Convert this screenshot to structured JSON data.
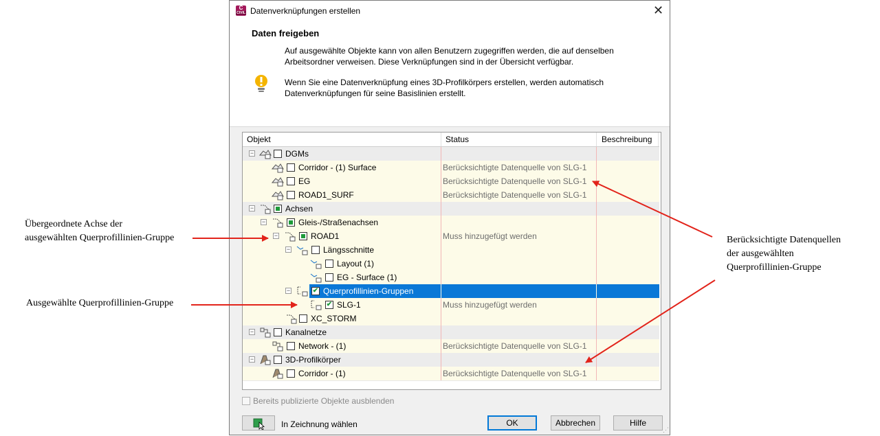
{
  "annotations": {
    "parent_axis": [
      "Übergeordnete Achse der",
      "ausgewählten Querprofillinien-Gruppe"
    ],
    "selected_group": "Ausgewählte Querprofillinien-Gruppe",
    "data_sources": [
      "Berücksichtigte Datenquellen",
      "der ausgewählten",
      "Querprofillinien-Gruppe"
    ],
    "arrow_color": "#e2231a"
  },
  "window": {
    "title": "Datenverknüpfungen erstellen",
    "app_icon_letter": "C",
    "app_icon_sub": "CIVIL",
    "close_glyph": "✕"
  },
  "header": {
    "title": "Daten freigeben",
    "paragraph1": [
      "Auf ausgewählte Objekte kann von allen Benutzern zugegriffen werden, die auf denselben",
      "Arbeitsordner verweisen. Diese Verknüpfungen sind in der Übersicht verfügbar."
    ],
    "paragraph2": [
      "Wenn Sie eine Datenverknüpfung eines 3D-Profilkörpers erstellen, werden automatisch",
      "Datenverknüpfungen für seine Basislinien erstellt."
    ],
    "info_icon": "lightbulb-icon"
  },
  "table": {
    "columns": [
      "Objekt",
      "Status",
      "Beschreibung"
    ],
    "rows": [
      {
        "label": "DGMs",
        "status": "",
        "kind": "group",
        "check": "none",
        "icon": "surface-folder-icon"
      },
      {
        "label": "Corridor - (1) Surface",
        "status": "Berücksichtigte Datenquelle von SLG-1",
        "kind": "item",
        "check": "none",
        "icon": "surface-icon"
      },
      {
        "label": "EG",
        "status": "Berücksichtigte Datenquelle von SLG-1",
        "kind": "item",
        "check": "none",
        "icon": "surface-icon"
      },
      {
        "label": "ROAD1_SURF",
        "status": "Berücksichtigte Datenquelle von SLG-1",
        "kind": "item",
        "check": "none",
        "icon": "surface-icon"
      },
      {
        "label": "Achsen",
        "status": "",
        "kind": "group",
        "check": "partial",
        "icon": "alignment-folder-icon"
      },
      {
        "label": "Gleis-/Straßenachsen",
        "status": "",
        "kind": "item",
        "check": "partial",
        "icon": "alignment-folder-icon"
      },
      {
        "label": "ROAD1",
        "status": "Muss hinzugefügt werden",
        "kind": "item",
        "check": "partial",
        "icon": "alignment-icon"
      },
      {
        "label": "Längsschnitte",
        "status": "",
        "kind": "item",
        "check": "none",
        "icon": "profile-folder-icon"
      },
      {
        "label": "Layout (1)",
        "status": "",
        "kind": "item",
        "check": "none",
        "icon": "profile-icon"
      },
      {
        "label": "EG - Surface (1)",
        "status": "",
        "kind": "item",
        "check": "none",
        "icon": "profile-icon"
      },
      {
        "label": "Querprofillinien-Gruppen",
        "status": "",
        "kind": "item",
        "check": "checked",
        "icon": "sample-line-folder-icon",
        "selected": true
      },
      {
        "label": "SLG-1",
        "status": "Muss hinzugefügt werden",
        "kind": "item",
        "check": "checked",
        "icon": "sample-line-icon"
      },
      {
        "label": "XC_STORM",
        "status": "",
        "kind": "item",
        "check": "none",
        "icon": "alignment-icon"
      },
      {
        "label": "Kanalnetze",
        "status": "",
        "kind": "group",
        "check": "none",
        "icon": "pipe-network-folder-icon"
      },
      {
        "label": "Network - (1)",
        "status": "Berücksichtigte Datenquelle von SLG-1",
        "kind": "item",
        "check": "none",
        "icon": "pipe-network-icon"
      },
      {
        "label": "3D-Profilkörper",
        "status": "",
        "kind": "group",
        "check": "none",
        "icon": "corridor-folder-icon"
      },
      {
        "label": "Corridor - (1)",
        "status": "Berücksichtigte Datenquelle von SLG-1",
        "kind": "item",
        "check": "none",
        "icon": "corridor-icon"
      }
    ]
  },
  "footer": {
    "hide_published": "Bereits publizierte Objekte ausblenden",
    "pick_in_drawing": "In Zeichnung wählen",
    "ok": "OK",
    "cancel": "Abbrechen",
    "help": "Hilfe"
  },
  "colors": {
    "selection": "#0a78d7",
    "check_green": "#1e9b3a",
    "row_item_bg": "#fdfbe8",
    "row_group_bg": "#ececec"
  }
}
